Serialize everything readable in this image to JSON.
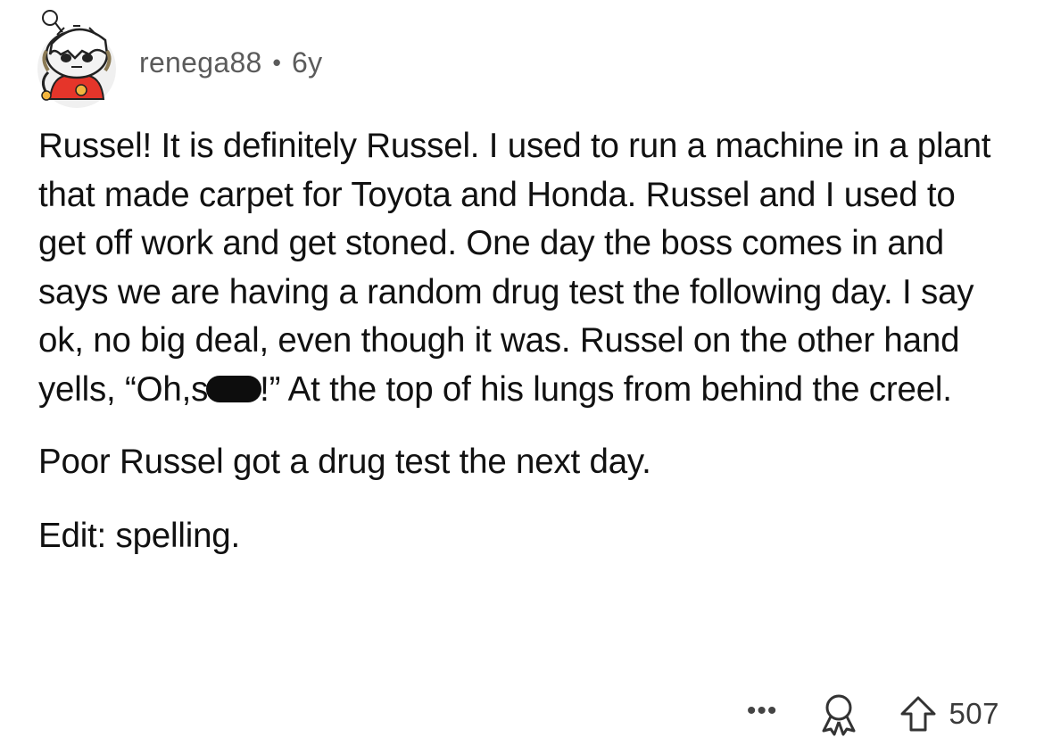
{
  "comment": {
    "author": "renega88",
    "separator": "•",
    "age": "6y",
    "paragraph1": {
      "before_redaction": "Russel!  It is definitely Russel. I used to run a machine in a plant that made carpet for Toyota and Honda. Russel and I used to get off work and get stoned. One day the boss comes in and says we are having a random drug test the following day. I say ok, no big deal, even though it was. Russel on the other hand yells, “Oh,s",
      "after_redaction": "!” At the top of his lungs from behind the creel."
    },
    "paragraph2": "Poor Russel got a drug test the next day.",
    "paragraph3": "Edit: spelling."
  },
  "actions": {
    "more_label": "•••",
    "award_icon": "award-ribbon-icon",
    "upvote_icon": "upvote-arrow-icon",
    "score": "507"
  },
  "avatar": {
    "icon": "snoo-avatar-icon",
    "colors": {
      "outfit": "#e5352a",
      "skin": "#f3b53e",
      "background": "#f2f2f2"
    }
  }
}
